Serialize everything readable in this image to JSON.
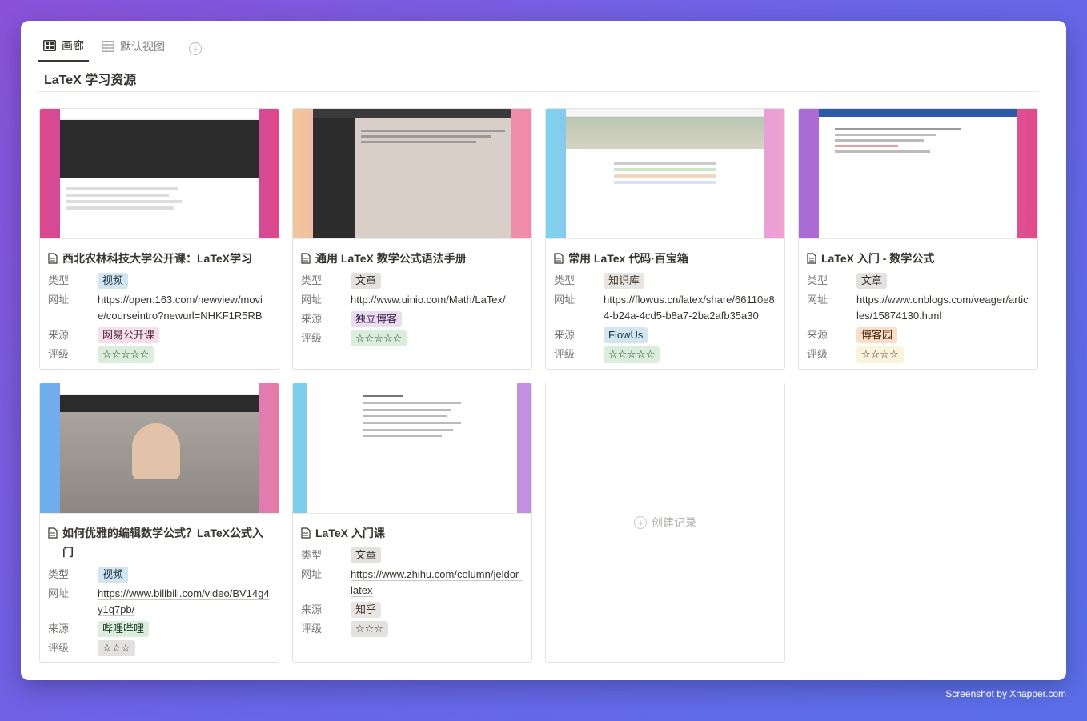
{
  "tabs": [
    {
      "label": "画廊",
      "icon": "gallery-icon"
    },
    {
      "label": "默认视图",
      "icon": "table-icon"
    }
  ],
  "database_title": "LaTeX 学习资源",
  "labels": {
    "type": "类型",
    "url": "网址",
    "source": "来源",
    "rating": "评级"
  },
  "cards": [
    {
      "title": "西北农林科技大学公开课：LaTeX学习",
      "type": "视频",
      "url": "https://open.163.com/newview/movie/courseintro?newurl=NHKF1R5RB",
      "source": "网易公开课",
      "rating": "☆☆☆☆☆"
    },
    {
      "title": "通用 LaTeX 数学公式语法手册",
      "type": "文章",
      "url": "http://www.uinio.com/Math/LaTex/",
      "source": "独立博客",
      "rating": "☆☆☆☆☆"
    },
    {
      "title": "常用 LaTex 代码·百宝箱",
      "type": "知识库",
      "url": "https://flowus.cn/latex/share/66110e84-b24a-4cd5-b8a7-2ba2afb35a30",
      "source": "FlowUs",
      "rating": "☆☆☆☆☆"
    },
    {
      "title": "LaTeX 入门 - 数学公式",
      "type": "文章",
      "url": "https://www.cnblogs.com/veager/articles/15874130.html",
      "source": "博客园",
      "rating": "☆☆☆☆"
    },
    {
      "title": "如何优雅的编辑数学公式？LaTeX公式入门",
      "type": "视频",
      "url": "https://www.bilibili.com/video/BV14g4y1q7pb/",
      "source": "哔哩哔哩",
      "rating": "☆☆☆"
    },
    {
      "title": "LaTeX 入门课",
      "type": "文章",
      "url": "https://www.zhihu.com/column/jeldor-latex",
      "source": "知乎",
      "rating": "☆☆☆"
    }
  ],
  "new_record_label": "创建记录",
  "watermark": "Screenshot by Xnapper.com",
  "colors": {
    "video_tag": "#d3e5ef",
    "article_tag": "#e3e2e0",
    "kb_tag": "#e9e5e3",
    "rating_green": "#dbeddb",
    "rating_yellow": "#fbf3db",
    "purple_tag": "#e8deee",
    "pink_tag": "#f5e0e9",
    "orange_tag": "#fadec9",
    "blue_tag": "#d3e5ef",
    "green_tag": "#dbeddb"
  }
}
